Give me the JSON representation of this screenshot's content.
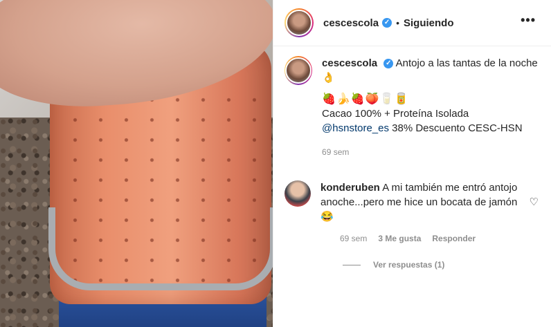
{
  "post": {
    "username": "cescescola",
    "follow_status": "Siguiendo",
    "separator": "•",
    "more_label": "•••"
  },
  "caption": {
    "username": "cescescola",
    "line1": "Antojo a las tantas de la noche👌",
    "emojis": "🍓🍌🍓🍑🥛🥫",
    "line2": "Cacao 100% + Proteína Isolada",
    "mention": "@hsnstore_es",
    "line3": " 38% Descuento CESC-HSN",
    "time": "69 sem"
  },
  "comment": {
    "username": "konderuben",
    "text": "A mi también me entró antojo anoche...pero me hice un bocata de jamón 😂",
    "time": "69 sem",
    "likes": "3 Me gusta",
    "reply": "Responder",
    "view_replies": "Ver respuestas (1)"
  },
  "icons": {
    "verified": "verified-badge-icon",
    "heart": "heart-icon",
    "more": "more-options-icon"
  },
  "colors": {
    "verified": "#3897f0",
    "link": "#00376b",
    "secondary_text": "#8e8e8e"
  }
}
